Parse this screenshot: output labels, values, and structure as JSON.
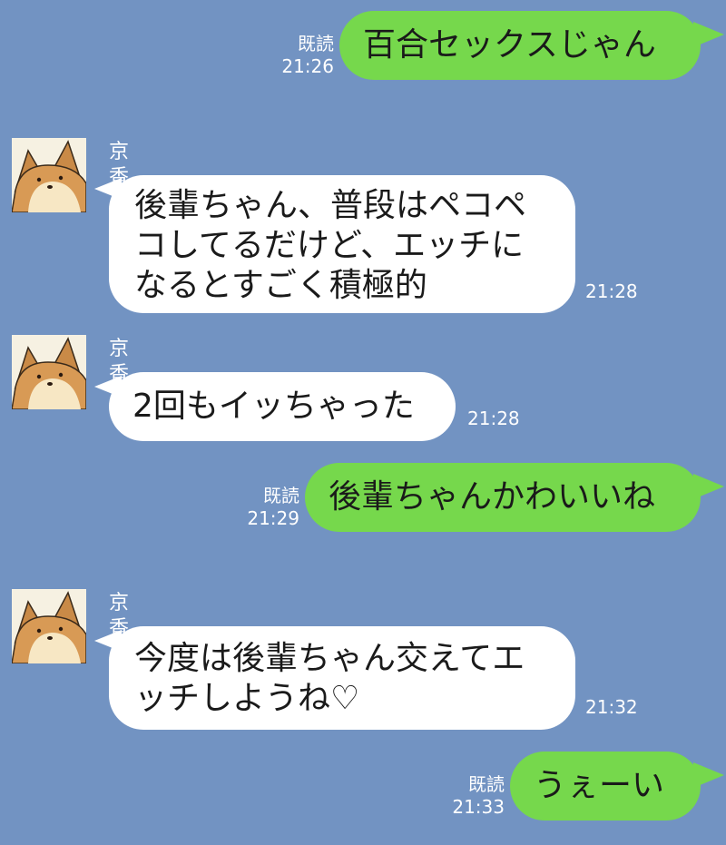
{
  "colors": {
    "background": "#7293c2",
    "outgoing_bubble": "#76d84c",
    "incoming_bubble": "#ffffff"
  },
  "messages": [
    {
      "direction": "outgoing",
      "read_label": "既読",
      "time": "21:26",
      "text": "百合セックスじゃん"
    },
    {
      "direction": "incoming",
      "sender": "京香",
      "avatar_icon": "shiba-dog-avatar",
      "time": "21:28",
      "text": "後輩ちゃん、普段はペコペ\nコしてるだけど、エッチに\nなるとすごく積極的"
    },
    {
      "direction": "incoming",
      "sender": "京香",
      "avatar_icon": "shiba-dog-avatar",
      "time": "21:28",
      "text": "2回もイッちゃった"
    },
    {
      "direction": "outgoing",
      "read_label": "既読",
      "time": "21:29",
      "text": "後輩ちゃんかわいいね"
    },
    {
      "direction": "incoming",
      "sender": "京香",
      "avatar_icon": "shiba-dog-avatar",
      "time": "21:32",
      "text": "今度は後輩ちゃん交えてエ\nッチしようね♡"
    },
    {
      "direction": "outgoing",
      "read_label": "既読",
      "time": "21:33",
      "text": "うぇーい"
    }
  ]
}
